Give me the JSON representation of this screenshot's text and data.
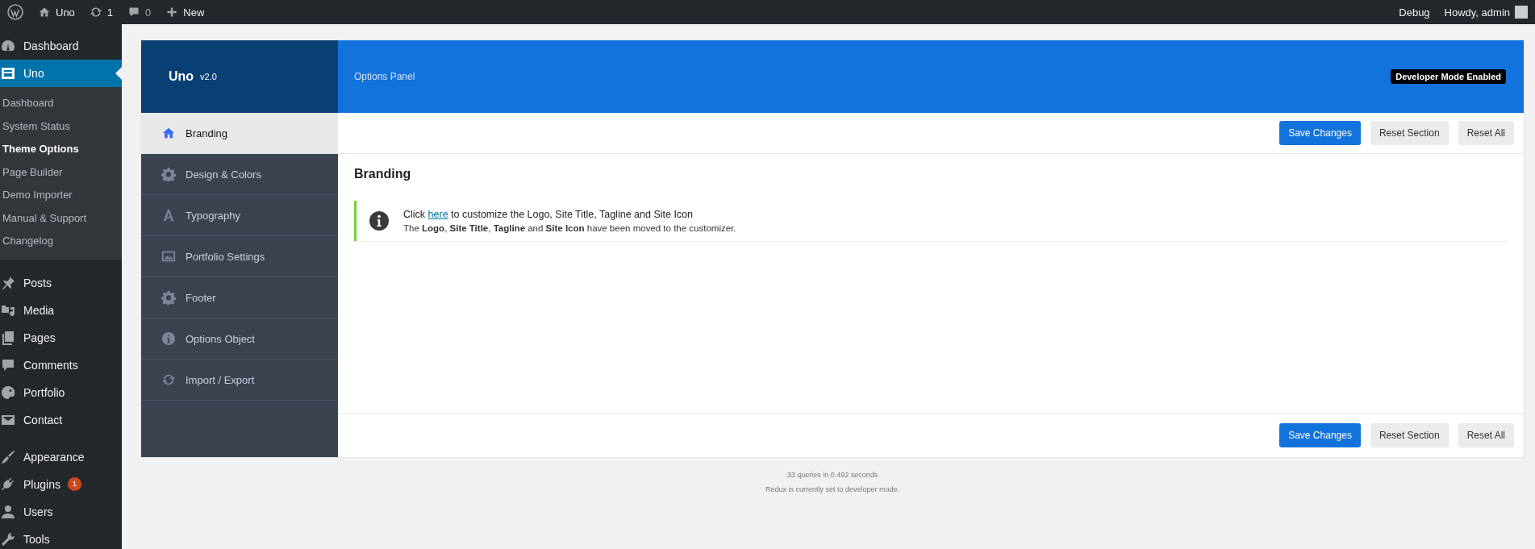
{
  "top_bar": {
    "site": "Uno",
    "updates": "1",
    "comments": "0",
    "new": "New",
    "right": [
      "Debug",
      "Howdy, admin"
    ]
  },
  "admin_menu": {
    "groups": [
      {
        "items": [
          {
            "label": "Dashboard",
            "selected": false
          },
          {
            "label": "Uno",
            "selected": true,
            "children": [
              {
                "label": "Dashboard",
                "selected": false
              },
              {
                "label": "System Status",
                "selected": false
              },
              {
                "label": "Theme Options",
                "selected": true
              },
              {
                "label": "Page Builder",
                "selected": false
              },
              {
                "label": "Demo Importer",
                "selected": false
              },
              {
                "label": "Manual & Support",
                "selected": false
              },
              {
                "label": "Changelog",
                "selected": false
              }
            ]
          }
        ]
      },
      {
        "items": [
          {
            "label": "Posts",
            "selected": false
          },
          {
            "label": "Media",
            "selected": false
          },
          {
            "label": "Pages",
            "selected": false
          },
          {
            "label": "Comments",
            "selected": false
          },
          {
            "label": "Portfolio",
            "selected": false
          },
          {
            "label": "Contact",
            "selected": false
          }
        ]
      },
      {
        "items": [
          {
            "label": "Appearance",
            "selected": false
          },
          {
            "label": "Plugins",
            "selected": false,
            "badge": "1"
          },
          {
            "label": "Users",
            "selected": false
          },
          {
            "label": "Tools",
            "selected": false
          }
        ]
      }
    ]
  },
  "panel": {
    "title": "Uno",
    "version": "v2.0",
    "subtitle": "Options Panel",
    "badge": "Developer Mode Enabled",
    "tabs": [
      {
        "label": "Branding",
        "selected": true
      },
      {
        "label": "Design & Colors",
        "selected": false
      },
      {
        "label": "Typography",
        "selected": false
      },
      {
        "label": "Portfolio Settings",
        "selected": false
      },
      {
        "label": "Footer",
        "selected": false
      },
      {
        "label": "Options Object",
        "selected": false
      },
      {
        "label": "Import / Export",
        "selected": false
      }
    ],
    "top_buttons": [
      {
        "label": "Save Changes",
        "kind": "primary"
      },
      {
        "label": "Reset Section",
        "kind": "secondary"
      },
      {
        "label": "Reset All",
        "kind": "secondary"
      }
    ],
    "section_title": "Branding",
    "notice": {
      "before": "Click",
      "link": "here",
      "after": "to customize the Logo, Site Title, Tagline and Site Icon",
      "detail": "The **Logo**, **Site Title**, **Tagline** and **Site Icon** have been moved to the customizer."
    },
    "bottom_buttons": [
      {
        "label": "Save Changes",
        "kind": "primary"
      },
      {
        "label": "Reset Section",
        "kind": "secondary"
      },
      {
        "label": "Reset All",
        "kind": "secondary"
      }
    ]
  },
  "footer": [
    "33 queries in 0.492 seconds",
    "Redux is currently set to developer mode."
  ]
}
